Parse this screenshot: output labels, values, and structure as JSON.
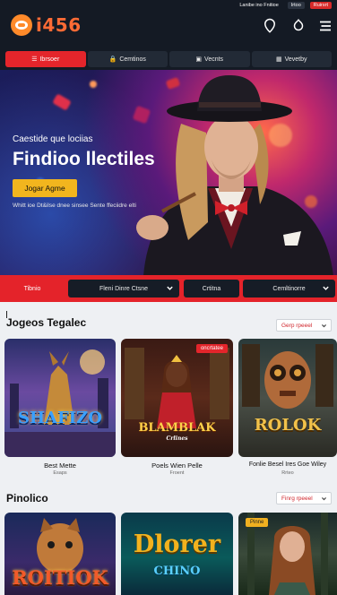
{
  "header": {
    "logo_text": "i456",
    "top_links": [
      "Lanibe ino Fnitioe",
      "Irtoo",
      "Ruirsrt"
    ],
    "icons": [
      "location-pin-icon",
      "settings-icon",
      "menu-icon"
    ]
  },
  "tabs": [
    {
      "label": "Ibrsoer",
      "icon": "☰",
      "active": true
    },
    {
      "label": "Cemtinos",
      "icon": "🔒",
      "active": false
    },
    {
      "label": "Vecnts",
      "icon": "▣",
      "active": false
    },
    {
      "label": "Vevetby",
      "icon": "▦",
      "active": false
    }
  ],
  "hero": {
    "subtitle": "Caestide que lociias",
    "title": "Findioo llectiles",
    "button_label": "Jogar Agme",
    "fine_print": "Whitt ioe Dt&ilse dnee sinsee Sente ffeciidre elti"
  },
  "filters": {
    "label": "Tibnio",
    "selects": [
      "Fleni Dinre Ctsne",
      "Crtitna",
      "Cemltinorre"
    ]
  },
  "sections": [
    {
      "title": "Jogeos Tegalec",
      "select_label": "Gerp rpeeel",
      "cards": [
        {
          "art_text": "SHAFIZO",
          "title": "Best Mette",
          "meta": "Esaps"
        },
        {
          "art_text": "BLAMBLAK",
          "art_sub": "Crlines",
          "title": "Poels Wien Pelle",
          "meta": "Froent",
          "badge": "oncrtatee"
        },
        {
          "art_text": "ROLOK",
          "title": "Fonlie Besel Ires Goe Wiley",
          "meta": "Rrteo"
        }
      ]
    },
    {
      "title": "Pinolico",
      "select_label": "Finrg rpeeel",
      "cards": [
        {
          "art_text": "ROITIOK",
          "title": "",
          "meta": ""
        },
        {
          "art_text": "Dlorer",
          "art_sub": "CHINO",
          "title": "",
          "meta": ""
        },
        {
          "art_text": "",
          "title": "",
          "meta": "",
          "badge": "Pinne"
        }
      ]
    }
  ],
  "colors": {
    "header_bg": "#141a24",
    "accent_red": "#e4252b",
    "accent_gold": "#f2b51e",
    "logo_orange": "#ff6b35"
  }
}
